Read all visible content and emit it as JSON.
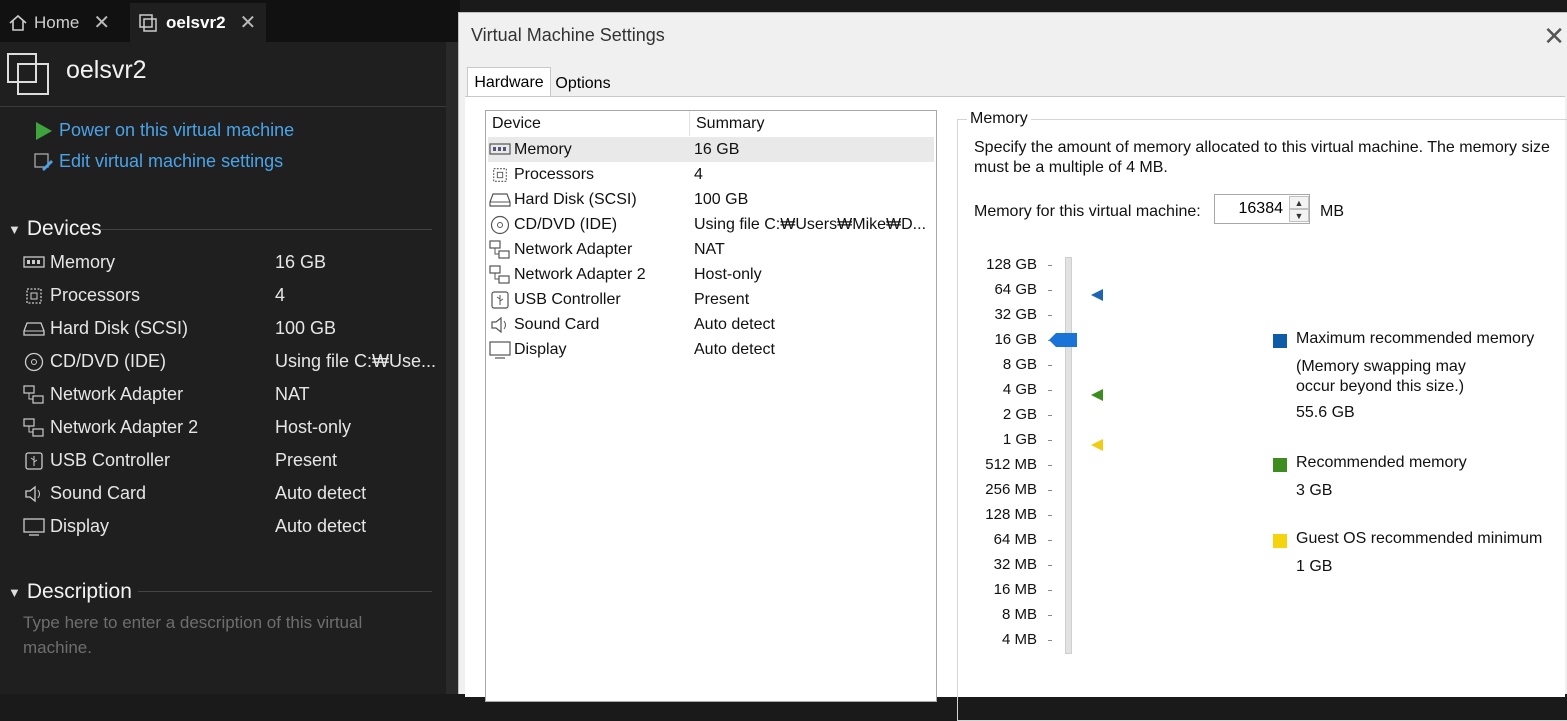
{
  "tabs": [
    {
      "label": "Home",
      "icon": "home-icon"
    },
    {
      "label": "oelsvr2",
      "icon": "vm-icon"
    }
  ],
  "vm": {
    "name": "oelsvr2",
    "actions": {
      "power_on": "Power on this virtual machine",
      "edit_settings": "Edit virtual machine settings"
    }
  },
  "devices_section": {
    "title": "Devices",
    "items": [
      {
        "name": "Memory",
        "value": "16 GB",
        "icon": "memory-icon"
      },
      {
        "name": "Processors",
        "value": "4",
        "icon": "processor-icon"
      },
      {
        "name": "Hard Disk (SCSI)",
        "value": "100 GB",
        "icon": "hard-disk-icon"
      },
      {
        "name": "CD/DVD (IDE)",
        "value": "Using file C:₩Use...",
        "icon": "cd-dvd-icon"
      },
      {
        "name": "Network Adapter",
        "value": "NAT",
        "icon": "network-icon"
      },
      {
        "name": "Network Adapter 2",
        "value": "Host-only",
        "icon": "network-icon"
      },
      {
        "name": "USB Controller",
        "value": "Present",
        "icon": "usb-icon"
      },
      {
        "name": "Sound Card",
        "value": "Auto detect",
        "icon": "sound-icon"
      },
      {
        "name": "Display",
        "value": "Auto detect",
        "icon": "display-icon"
      }
    ]
  },
  "description_section": {
    "title": "Description",
    "placeholder": "Type here to enter a description of this virtual machine."
  },
  "dialog": {
    "title": "Virtual Machine Settings",
    "tabs": [
      "Hardware",
      "Options"
    ],
    "device_list": {
      "headers": {
        "device": "Device",
        "summary": "Summary"
      },
      "rows": [
        {
          "device": "Memory",
          "summary": "16 GB",
          "icon": "memory-icon",
          "selected": true
        },
        {
          "device": "Processors",
          "summary": "4",
          "icon": "processor-icon"
        },
        {
          "device": "Hard Disk (SCSI)",
          "summary": "100 GB",
          "icon": "hard-disk-icon"
        },
        {
          "device": "CD/DVD (IDE)",
          "summary": "Using file C:₩Users₩Mike₩D...",
          "icon": "cd-dvd-icon"
        },
        {
          "device": "Network Adapter",
          "summary": "NAT",
          "icon": "network-icon"
        },
        {
          "device": "Network Adapter 2",
          "summary": "Host-only",
          "icon": "network-icon"
        },
        {
          "device": "USB Controller",
          "summary": "Present",
          "icon": "usb-icon"
        },
        {
          "device": "Sound Card",
          "summary": "Auto detect",
          "icon": "sound-icon"
        },
        {
          "device": "Display",
          "summary": "Auto detect",
          "icon": "display-icon"
        }
      ]
    },
    "memory": {
      "group_title": "Memory",
      "description": "Specify the amount of memory allocated to this virtual machine. The memory size must be a multiple of 4 MB.",
      "field_label": "Memory for this virtual machine:",
      "value": "16384",
      "unit": "MB",
      "scale_labels": [
        "128 GB",
        "64 GB",
        "32 GB",
        "16 GB",
        "8 GB",
        "4 GB",
        "2 GB",
        "1 GB",
        "512 MB",
        "256 MB",
        "128 MB",
        "64 MB",
        "32 MB",
        "16 MB",
        "8 MB",
        "4 MB"
      ],
      "current_level": "16 GB",
      "markers": [
        {
          "level": "64 GB",
          "color": "#1e64b4"
        },
        {
          "level": "4 GB",
          "color": "#3c8c1e"
        },
        {
          "level": "1 GB",
          "color": "#f0cc14"
        }
      ],
      "legend": {
        "max": {
          "label": "Maximum recommended memory",
          "note": "(Memory swapping may occur beyond this size.)",
          "value": "55.6 GB",
          "color": "#0e5ca8"
        },
        "recommended": {
          "label": "Recommended memory",
          "value": "3 GB",
          "color": "#3c8c1e"
        },
        "guest_min": {
          "label": "Guest OS recommended minimum",
          "value": "1 GB",
          "color": "#f5d40f"
        }
      }
    }
  }
}
